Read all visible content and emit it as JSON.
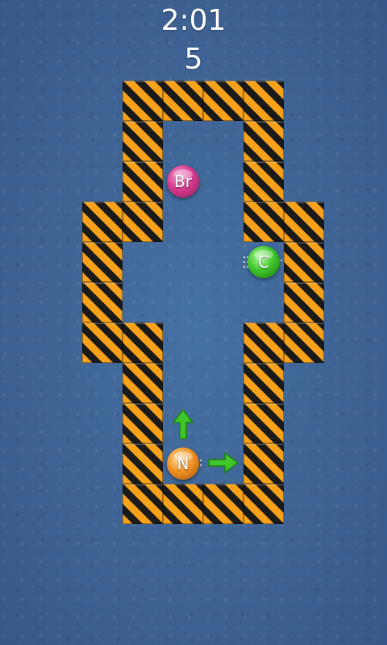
{
  "hud": {
    "timer": "2:01",
    "moves": "5"
  },
  "atoms": {
    "br": {
      "symbol": "Br",
      "color": "#d83b8f"
    },
    "c": {
      "symbol": "C",
      "color": "#3fc72b"
    },
    "n": {
      "symbol": "N",
      "color": "#f29324"
    }
  },
  "controls": {
    "up_arrow_icon": "arrow-up-icon",
    "right_arrow_icon": "arrow-right-icon",
    "arrow_color": "#3fc72b"
  },
  "theme": {
    "background": "#3f6596",
    "wall_stripe_a": "#f7a21a",
    "wall_stripe_b": "#1a1a1a"
  }
}
